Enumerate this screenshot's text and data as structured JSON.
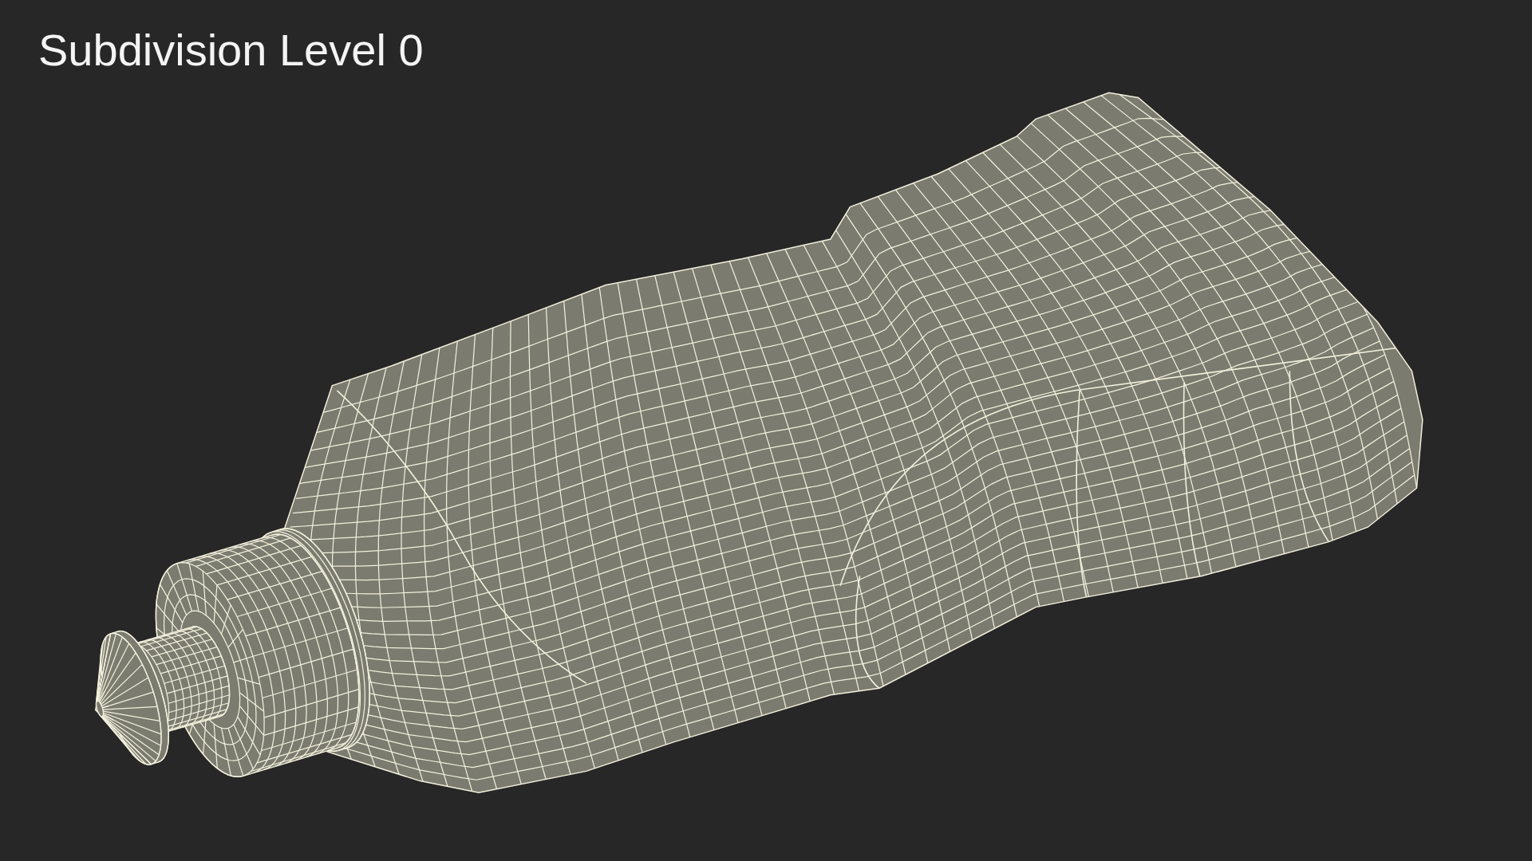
{
  "title": "Subdivision Level 0"
}
